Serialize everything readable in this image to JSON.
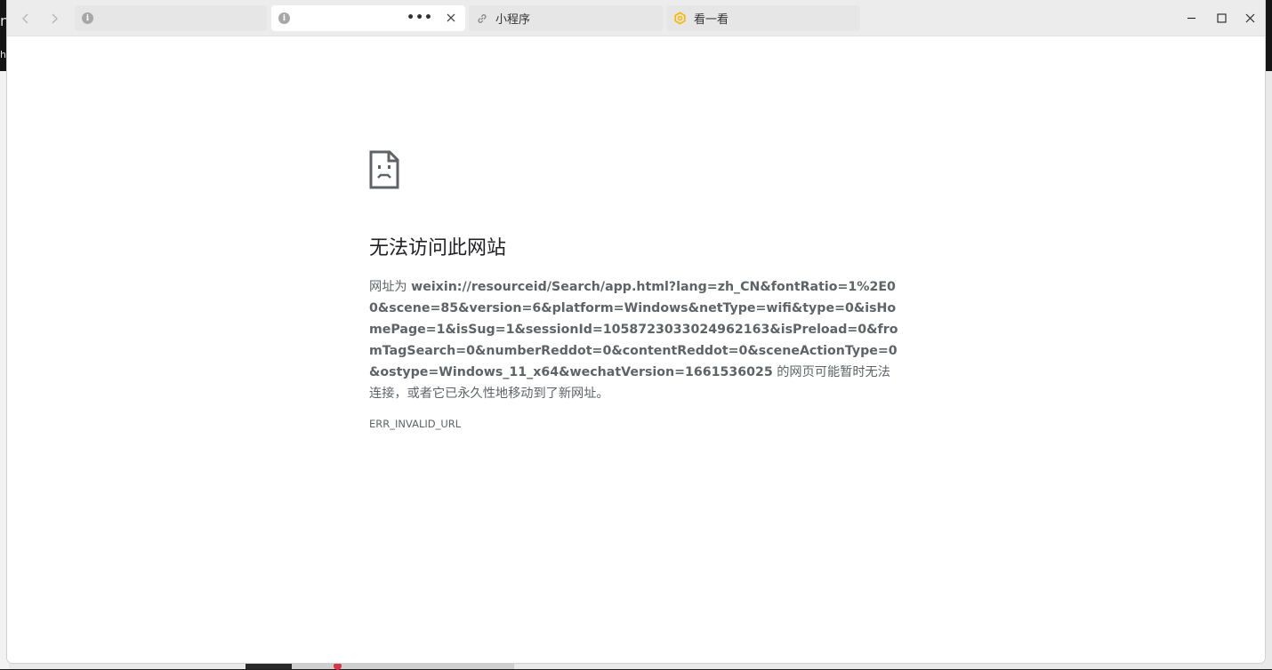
{
  "desktop": {
    "left_fragment_top": "n",
    "left_fragment_mid": "he"
  },
  "tabs": [
    {
      "label": "",
      "icon": "info-icon",
      "active": false
    },
    {
      "label": "",
      "icon": "info-icon",
      "active": true,
      "more": "•••"
    },
    {
      "label": "小程序",
      "icon": "link-icon",
      "active": false
    },
    {
      "label": "看一看",
      "icon": "look-icon",
      "active": false
    }
  ],
  "error": {
    "title": "无法访问此网站",
    "prefix": "网址为",
    "url": "weixin://resourceid/Search/app.html?lang=zh_CN&fontRatio=1%2E00&scene=85&version=6&platform=Windows&netType=wifi&type=0&isHomePage=1&isSug=1&sessionId=1058723033024962163&isPreload=0&fromTagSearch=0&numberReddot=0&contentReddot=0&sceneActionType=0&ostype=Windows_11_x64&wechatVersion=1661536025",
    "suffix": "的网页可能暂时无法连接，或者它已永久性地移动到了新网址。",
    "code": "ERR_INVALID_URL"
  },
  "colors": {
    "titlebar": "#ececec",
    "tab_inactive": "#e6e6e6",
    "tab_active": "#ffffff",
    "look_icon": "#f5b800",
    "text_muted": "#5f6368",
    "title_text": "#202124"
  }
}
